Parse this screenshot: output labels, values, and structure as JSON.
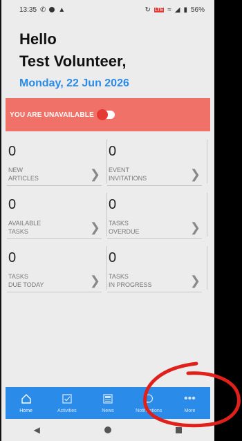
{
  "status_bar": {
    "time": "13:35",
    "battery": "56%",
    "icons_left": [
      "whatsapp-icon",
      "record-dot-icon",
      "app-icon"
    ],
    "icons_right": [
      "vibrate-icon",
      "volte-icon",
      "wifi-icon",
      "signal-icon",
      "battery-icon"
    ]
  },
  "greeting": {
    "line1": "Hello",
    "line2": "Test Volunteer,"
  },
  "date": "Monday, 22 Jun 2026",
  "availability": {
    "label": "YOU ARE UNAVAILABLE",
    "toggled": false
  },
  "tiles": [
    {
      "count": "0",
      "label": "NEW\nARTICLES"
    },
    {
      "count": "0",
      "label": "EVENT\nINVITATIONS"
    },
    {
      "count": "0",
      "label": "AVAILABLE\nTASKS"
    },
    {
      "count": "0",
      "label": "TASKS\nOVERDUE"
    },
    {
      "count": "0",
      "label": "TASKS\nDUE TODAY"
    },
    {
      "count": "0",
      "label": "TASKS\nIN PROGRESS"
    }
  ],
  "bottom_nav": [
    {
      "label": "Home",
      "icon": "home-icon"
    },
    {
      "label": "Activities",
      "icon": "checkbox-icon"
    },
    {
      "label": "News",
      "icon": "news-icon"
    },
    {
      "label": "Notifications",
      "icon": "chat-bubble-icon"
    },
    {
      "label": "More",
      "icon": "more-dots-icon"
    }
  ],
  "colors": {
    "accent": "#2a8be8",
    "unavailable_banner": "#f07167",
    "toggle_knob": "#e53935",
    "annotation": "#e0201a"
  }
}
